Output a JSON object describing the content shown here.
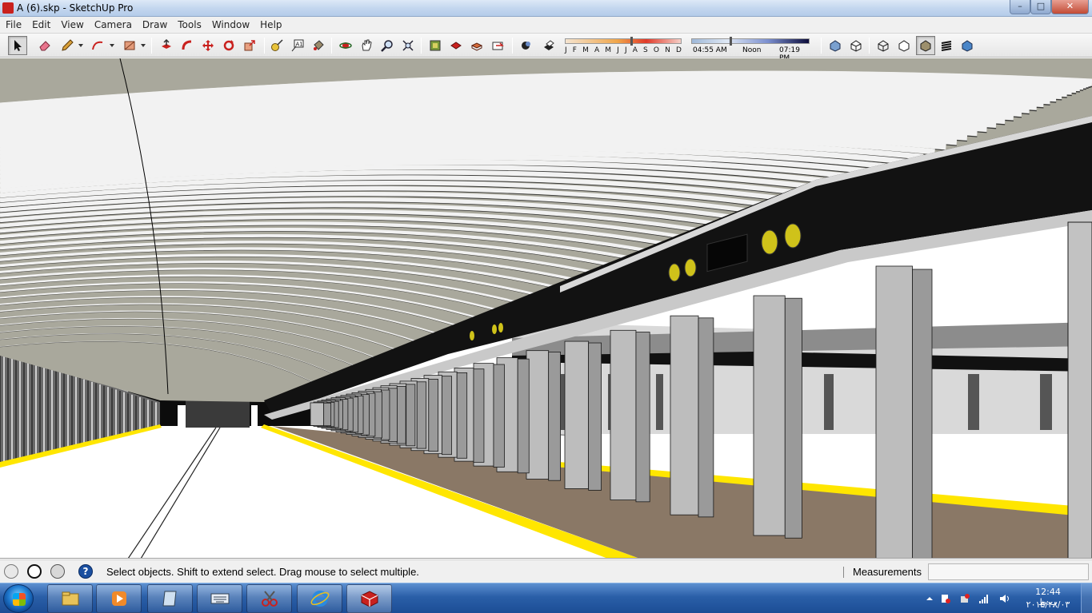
{
  "window": {
    "title": "A (6).skp - SketchUp Pro",
    "minimize": "–",
    "maximize": "□",
    "close": "✕"
  },
  "menu": [
    "File",
    "Edit",
    "View",
    "Camera",
    "Draw",
    "Tools",
    "Window",
    "Help"
  ],
  "toolbar": {
    "tools": [
      {
        "name": "select-tool-button",
        "icon": "arrow-cursor-icon",
        "active": true
      },
      {
        "name": "eraser-tool-button",
        "icon": "eraser-icon"
      },
      {
        "name": "line-tool-button",
        "icon": "pencil-icon"
      },
      {
        "name": "arc-tool-button",
        "icon": "arc-icon"
      },
      {
        "name": "shape-tool-button",
        "icon": "rectangle-icon"
      },
      {
        "name": "push-pull-tool-button",
        "icon": "push-pull-icon"
      },
      {
        "name": "follow-me-tool-button",
        "icon": "follow-me-icon"
      },
      {
        "name": "move-tool-button",
        "icon": "move-icon"
      },
      {
        "name": "rotate-tool-button",
        "icon": "rotate-icon"
      },
      {
        "name": "scale-tool-button",
        "icon": "scale-icon"
      },
      {
        "name": "tape-measure-tool-button",
        "icon": "tape-measure-icon"
      },
      {
        "name": "text-tool-button",
        "icon": "text-icon"
      },
      {
        "name": "paint-bucket-tool-button",
        "icon": "paint-bucket-icon"
      },
      {
        "name": "orbit-tool-button",
        "icon": "orbit-icon"
      },
      {
        "name": "pan-tool-button",
        "icon": "pan-hand-icon"
      },
      {
        "name": "zoom-tool-button",
        "icon": "zoom-icon"
      },
      {
        "name": "zoom-extents-button",
        "icon": "zoom-extents-icon"
      },
      {
        "name": "warehouse-button",
        "icon": "warehouse-icon"
      },
      {
        "name": "share-model-button",
        "icon": "share-model-icon"
      },
      {
        "name": "components-button",
        "icon": "components-icon"
      },
      {
        "name": "extension-button",
        "icon": "extension-icon"
      },
      {
        "name": "shadows-toggle-button",
        "icon": "shadow-icon"
      },
      {
        "name": "fog-toggle-button",
        "icon": "fog-icon"
      },
      {
        "name": "xray-style-button",
        "icon": "xray-icon"
      },
      {
        "name": "back-edges-style-button",
        "icon": "back-edges-icon"
      },
      {
        "name": "wireframe-style-button",
        "icon": "wireframe-icon"
      },
      {
        "name": "hidden-line-style-button",
        "icon": "hidden-line-icon"
      },
      {
        "name": "shaded-style-button",
        "icon": "shaded-icon",
        "active": true
      },
      {
        "name": "shaded-textures-style-button",
        "icon": "shaded-textures-icon"
      },
      {
        "name": "monochrome-style-button",
        "icon": "monochrome-icon"
      }
    ],
    "months": [
      "J",
      "F",
      "M",
      "A",
      "M",
      "J",
      "J",
      "A",
      "S",
      "O",
      "N",
      "D"
    ],
    "month_position": 0.57,
    "time_start": "04:55 AM",
    "time_noon": "Noon",
    "time_end": "07:19 PM",
    "time_position": 0.33
  },
  "status": {
    "text": "Select objects. Shift to extend select. Drag mouse to select multiple.",
    "measurements_label": "Measurements",
    "measurements_value": ""
  },
  "taskbar": {
    "apps": [
      {
        "name": "explorer-taskbar-button",
        "icon": "folder-icon"
      },
      {
        "name": "media-player-taskbar-button",
        "icon": "media-player-icon"
      },
      {
        "name": "notepad-taskbar-button",
        "icon": "notepad-icon"
      },
      {
        "name": "keyboard-taskbar-button",
        "icon": "keyboard-icon"
      },
      {
        "name": "snipping-tool-taskbar-button",
        "icon": "scissors-icon"
      },
      {
        "name": "internet-explorer-taskbar-button",
        "icon": "ie-icon"
      },
      {
        "name": "sketchup-taskbar-button",
        "icon": "sketchup-icon",
        "active": true
      }
    ],
    "clock_time": "12:44 ب.ظ",
    "clock_date": "۲۰۱۵/۲۸/۰۳"
  },
  "colors": {
    "platform_edge": "#ffe600",
    "ceiling": "#a9a89c",
    "beam": "#121212",
    "column": "#b9b9b9",
    "track_bed": "#8a7866",
    "signal": "#cfc21a"
  }
}
